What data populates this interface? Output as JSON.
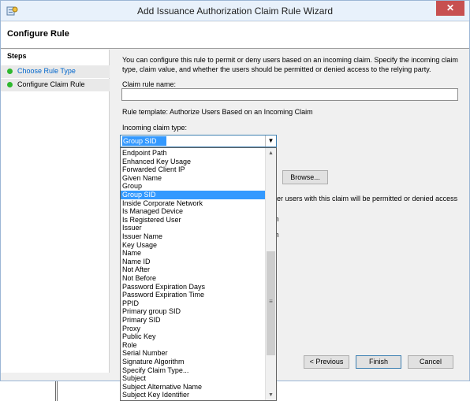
{
  "window": {
    "title": "Add Issuance Authorization Claim Rule Wizard",
    "close_label": "✕"
  },
  "header": {
    "title": "Configure Rule"
  },
  "steps": {
    "heading": "Steps",
    "items": [
      {
        "label": "Choose Rule Type",
        "status": "complete"
      },
      {
        "label": "Configure Claim Rule",
        "status": "current"
      }
    ]
  },
  "main": {
    "description": "You can configure this rule to permit or deny users based on an incoming claim. Specify the incoming claim type, claim value, and whether the users should be permitted or denied access to the relying party.",
    "claim_rule_name_label": "Claim rule name:",
    "claim_rule_name_value": "",
    "rule_template": "Rule template: Authorize Users Based on an Incoming Claim",
    "incoming_claim_type_label": "Incoming claim type:",
    "incoming_claim_type_value": "Group SID",
    "browse_label": "Browse...",
    "partial_text": "her users with this claim will be permitted or denied access",
    "partial_m1": "m",
    "partial_m2": "m"
  },
  "dropdown": {
    "selected": "Group SID",
    "items": [
      "Endpoint Path",
      "Enhanced Key Usage",
      "Forwarded Client IP",
      "Given Name",
      "Group",
      "Group SID",
      "Inside Corporate Network",
      "Is Managed Device",
      "Is Registered User",
      "Issuer",
      "Issuer Name",
      "Key Usage",
      "Name",
      "Name ID",
      "Not After",
      "Not Before",
      "Password Expiration Days",
      "Password Expiration Time",
      "PPID",
      "Primary group SID",
      "Primary SID",
      "Proxy",
      "Public Key",
      "Role",
      "Serial Number",
      "Signature Algorithm",
      "Specify Claim Type...",
      "Subject",
      "Subject Alternative Name",
      "Subject Key Identifier"
    ]
  },
  "footer": {
    "previous_label": "< Previous",
    "finish_label": "Finish",
    "cancel_label": "Cancel"
  },
  "colors": {
    "accent": "#3399ff",
    "step_complete": "#2eb82e",
    "link": "#0066cc",
    "close_button": "#c75050"
  }
}
